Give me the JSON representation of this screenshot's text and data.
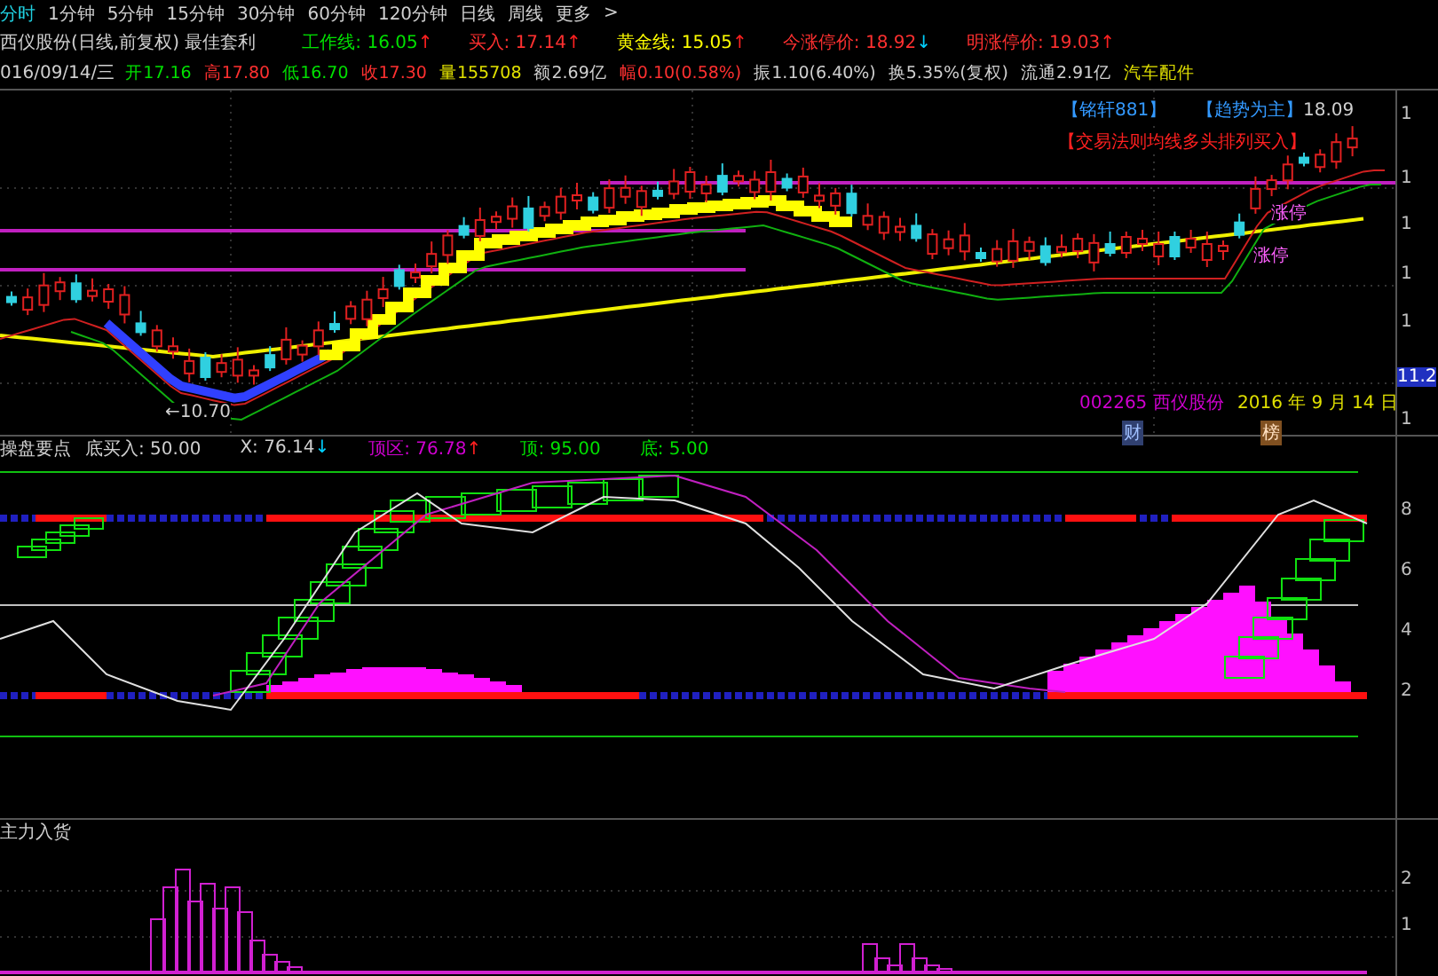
{
  "timeframe_tabs": [
    {
      "label": "分时",
      "selected": true
    },
    {
      "label": "1分钟",
      "selected": false
    },
    {
      "label": "5分钟",
      "selected": false
    },
    {
      "label": "15分钟",
      "selected": false
    },
    {
      "label": "30分钟",
      "selected": false
    },
    {
      "label": "60分钟",
      "selected": false
    },
    {
      "label": "120分钟",
      "selected": false
    },
    {
      "label": "日线",
      "selected": false
    },
    {
      "label": "周线",
      "selected": false
    },
    {
      "label": "更多",
      "selected": false
    }
  ],
  "more_arrow": ">",
  "title_line": {
    "title": "西仪股份(日线,前复权) 最佳套利",
    "indicators": [
      {
        "label": "工作线: ",
        "value": "16.05",
        "arrow": {
          "text": "↑",
          "color": "#ff2020"
        },
        "color": "#00e000"
      },
      {
        "label": "买入: ",
        "value": "17.14",
        "arrow": {
          "text": "↑",
          "color": "#ff2020"
        },
        "color": "#ff3030"
      },
      {
        "label": "黄金线: ",
        "value": "15.05",
        "arrow": {
          "text": "↑",
          "color": "#ff2020"
        },
        "color": "#ffff00"
      },
      {
        "label": "今涨停价: ",
        "value": "18.92",
        "arrow": {
          "text": "↓",
          "color": "#00d0ff"
        },
        "color": "#ff3030"
      },
      {
        "label": "明涨停价: ",
        "value": "19.03",
        "arrow": {
          "text": "↑",
          "color": "#ff2020"
        },
        "color": "#ff3030"
      }
    ]
  },
  "quote_line": {
    "date": "016/09/14/三",
    "stats": [
      {
        "label": "开",
        "value": "17.16",
        "color": "#00e000"
      },
      {
        "label": "高",
        "value": "17.80",
        "color": "#ff3030"
      },
      {
        "label": "低",
        "value": "16.70",
        "color": "#00e000"
      },
      {
        "label": "收",
        "value": "17.30",
        "color": "#ff3030"
      },
      {
        "label": "量",
        "value": "155708",
        "color": "#e0e000"
      },
      {
        "label": "额",
        "value": "2.69亿",
        "color": "#d0d0d0"
      },
      {
        "label": "幅",
        "value": "0.10(0.58%)",
        "color": "#ff3030"
      },
      {
        "label": "振",
        "value": "1.10(6.40%)",
        "color": "#d0d0d0"
      },
      {
        "label": "换",
        "value": "5.35%(复权)",
        "color": "#d0d0d0"
      },
      {
        "label": "流通",
        "value": "2.91亿",
        "color": "#d0d0d0"
      },
      {
        "value": "汽车配件",
        "color": "#e0e000"
      }
    ]
  },
  "main_chart": {
    "labels": [
      {
        "text": "【铭轩881】",
        "color": "#3399ff"
      },
      {
        "text": "【趋势为主】",
        "color": "#3399ff"
      },
      {
        "text": "18.09",
        "color": "#d0d0d0"
      },
      {
        "text": "【交易法则均线多头排列买入】",
        "color": "#ff2020"
      },
      {
        "text": "涨停",
        "color": "#ff60ff"
      },
      {
        "text": "涨停",
        "color": "#ff60ff"
      },
      {
        "text": "←10.70",
        "color": "#d0d0d0"
      },
      {
        "text": "002265 西仪股份",
        "color": "#d000d0"
      },
      {
        "text": "2016 年 9 月 14 日",
        "color": "#e0e000"
      }
    ],
    "markers": [
      "财",
      "榜"
    ],
    "axis": [
      "1",
      "1",
      "1",
      "1",
      "1",
      "11.2",
      "1"
    ]
  },
  "indicator_panel": {
    "title": "操盘要点",
    "items": [
      {
        "label": "底买入: ",
        "value": "50.00",
        "color": "#d0d0d0"
      },
      {
        "label": "X: ",
        "value": "76.14",
        "arrow": {
          "text": "↓",
          "color": "#00d0ff"
        },
        "color": "#d0d0d0"
      },
      {
        "label": "顶区: ",
        "value": "76.78",
        "arrow": {
          "text": "↑",
          "color": "#ff2020"
        },
        "color": "#d000d0"
      },
      {
        "label": "顶: ",
        "value": "95.00",
        "color": "#00e000"
      },
      {
        "label": "底: ",
        "value": "5.00",
        "color": "#00e000"
      }
    ],
    "axis": [
      "8",
      "6",
      "4",
      "2"
    ]
  },
  "volume_panel": {
    "title": "主力入货",
    "axis": [
      "2",
      "1"
    ]
  }
}
